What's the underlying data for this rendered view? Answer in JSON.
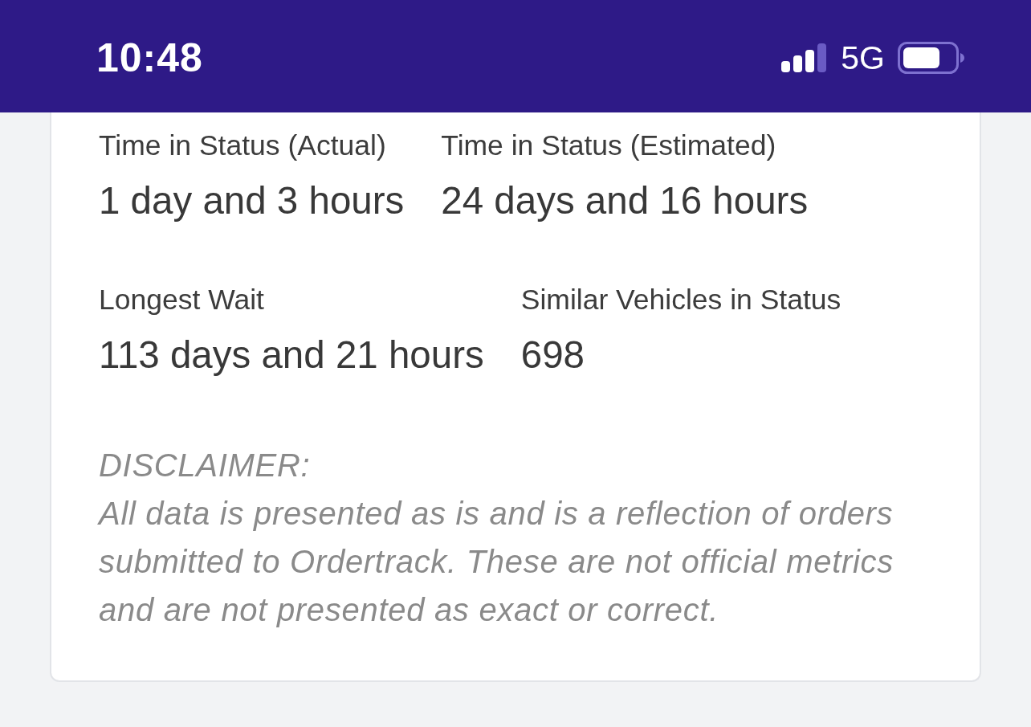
{
  "status_bar": {
    "time": "10:48",
    "network": "5G"
  },
  "stats": {
    "rows": [
      [
        {
          "label": "Time in Status (Actual)",
          "value": "1 day and 3 hours"
        },
        {
          "label": "Time in Status (Estimated)",
          "value": "24 days and 16 hours"
        }
      ],
      [
        {
          "label": "Longest Wait",
          "value": "113 days and 21 hours"
        },
        {
          "label": "Similar Vehicles in Status",
          "value": "698"
        }
      ]
    ]
  },
  "disclaimer": {
    "heading": "DISCLAIMER:",
    "text": "All data is presented as is and is a reflection of orders submitted to Ordertrack. These are not official metrics and are not presented as exact or correct."
  }
}
